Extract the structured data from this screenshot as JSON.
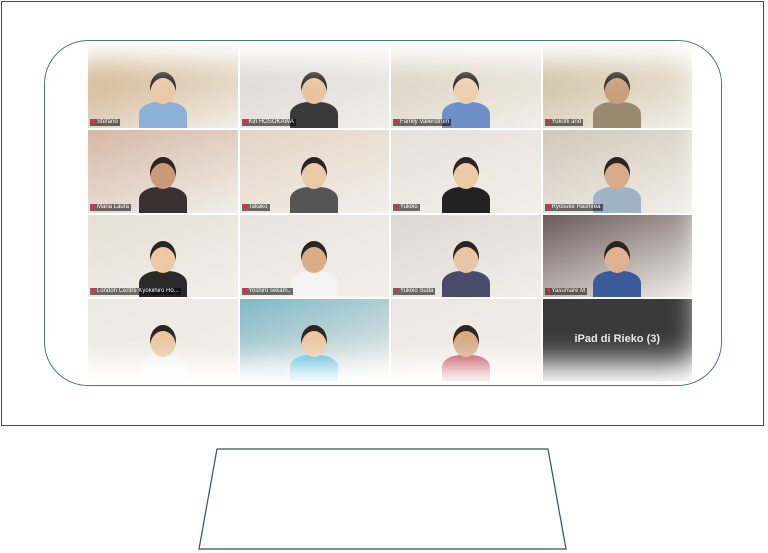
{
  "meeting": {
    "participants": [
      {
        "name": "Stefano",
        "bg": "#c9a77a",
        "skin": "#e9c9a8",
        "shirt": "#8db0d8"
      },
      {
        "name": "Kiri HOSOKAWA",
        "bg": "#d8d4cf",
        "skin": "#e8c4a0",
        "shirt": "#3a3a3a"
      },
      {
        "name": "Family Vallerstrom",
        "bg": "#d7cbb8",
        "skin": "#edd0b0",
        "shirt": "#6f8fc8"
      },
      {
        "name": "Yukofk and",
        "bg": "#c7b590",
        "skin": "#c8a07a",
        "shirt": "#9a8a70"
      },
      {
        "name": "Maria Laura",
        "bg": "#d5b8a5",
        "skin": "#c89a7a",
        "shirt": "#3a3030"
      },
      {
        "name": "Takako",
        "bg": "#e4d4c4",
        "skin": "#eccaa8",
        "shirt": "#555555"
      },
      {
        "name": "Yukiko",
        "bg": "#e6e2da",
        "skin": "#ebcaa8",
        "shirt": "#222222"
      },
      {
        "name": "Ryosuke Hashirea",
        "bg": "#d2c7ba",
        "skin": "#d8ac88",
        "shirt": "#9fb2c6"
      },
      {
        "name": "London Centre Kyokiihiro Ho...",
        "bg": "#e6e0d6",
        "skin": "#ecc8a4",
        "shirt": "#2a2a2a"
      },
      {
        "name": "Yoshiro sekam..",
        "bg": "#e8e4de",
        "skin": "#d8ae88",
        "shirt": "#f3f3f3"
      },
      {
        "name": "Yukiko Suda",
        "bg": "#dcd8d4",
        "skin": "#e9c7a6",
        "shirt": "#4a4a6a"
      },
      {
        "name": "Yasumare M",
        "bg": "#6a5a58",
        "skin": "#e0b294",
        "shirt": "#3a5a9a"
      },
      {
        "name": "",
        "bg": "#ece8e2",
        "skin": "#e8c6a2",
        "shirt": "#f4f4f4"
      },
      {
        "name": "",
        "bg": "#7fb8c8",
        "skin": "#ecc8a4",
        "shirt": "#4fb8d8"
      },
      {
        "name": "",
        "bg": "#ebe7e2",
        "skin": "#d8aa86",
        "shirt": "#c04050"
      },
      {
        "name": "iPad di Rieko (3)",
        "bg": "#3a3a3a",
        "skin": "",
        "shirt": "",
        "video_off": true
      }
    ]
  },
  "colors": {
    "frame": "#2f4f7a",
    "screen_border": "#4f6f9a"
  }
}
